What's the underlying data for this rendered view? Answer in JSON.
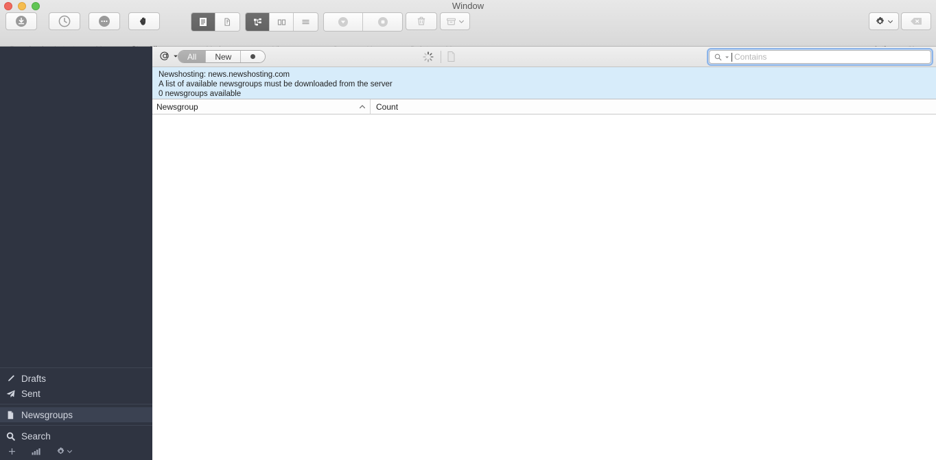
{
  "window": {
    "title": "Window",
    "traffic_lights": [
      "close",
      "minimize",
      "zoom"
    ]
  },
  "toolbar": {
    "groups": [
      {
        "name": "download",
        "buttons": [
          {
            "icon": "download-circle-icon",
            "label": "Download",
            "enabled": false
          },
          {
            "icon": "clock-icon",
            "label": "Latest",
            "enabled": false
          },
          {
            "icon": "ellipsis-circle-icon",
            "label": "More",
            "enabled": false
          },
          {
            "icon": "stop-hand-icon",
            "label": "Stop All",
            "enabled": true
          }
        ]
      }
    ],
    "mode": {
      "label": "Mode",
      "segments": [
        {
          "icon": "article-view-icon",
          "selected": true
        },
        {
          "icon": "pages-copy-icon",
          "selected": false
        }
      ]
    },
    "view": {
      "label": "View",
      "segments": [
        {
          "icon": "hierarchy-tree-icon",
          "selected": true
        },
        {
          "icon": "two-column-icon",
          "selected": false
        },
        {
          "icon": "list-lines-icon",
          "selected": false
        }
      ]
    },
    "actions": [
      {
        "icon": "queue-chevron-circle-icon",
        "label": "Queue",
        "enabled": false
      },
      {
        "icon": "unqueue-square-circle-icon",
        "label": "Unqueue",
        "enabled": false
      },
      {
        "icon": "trash-icon",
        "label": "Delete",
        "enabled": false
      },
      {
        "icon": "archive-box-icon",
        "label": "Move",
        "enabled": false,
        "has_chevron": true
      }
    ],
    "right": [
      {
        "icon": "gear-icon",
        "label": "Action",
        "enabled": true,
        "has_chevron": true
      },
      {
        "icon": "clear-backspace-icon",
        "label": "Clear",
        "enabled": false
      }
    ]
  },
  "filterbar": {
    "at_menu": {
      "icon": "at-sign-icon",
      "chevron": "chevron-down-icon"
    },
    "filters": [
      {
        "label": "All",
        "selected": true
      },
      {
        "label": "New",
        "selected": false
      },
      {
        "label": "",
        "selected": false,
        "icon": "dot-icon"
      }
    ],
    "progress_spinner": "loading-spinner-icon",
    "document_icon": "document-icon",
    "search": {
      "icon": "search-magnifier-icon",
      "chevron": "chevron-down-icon",
      "placeholder": "Contains",
      "value": "",
      "focused": true
    }
  },
  "banner": {
    "lines": [
      "Newshosting: news.newshosting.com",
      "A list of available newsgroups must be downloaded from the server",
      "0 newsgroups available"
    ],
    "background_color": "#d7ecfa"
  },
  "table": {
    "columns": [
      {
        "label": "Newsgroup",
        "sort": "ascending"
      },
      {
        "label": "Count",
        "sort": "none"
      }
    ],
    "rows": []
  },
  "sidebar": {
    "background_color": "#2f3441",
    "selected_color": "#3b4252",
    "groups": [
      {
        "items": [
          {
            "icon": "pencil-icon",
            "label": "Drafts",
            "selected": false
          },
          {
            "icon": "paper-plane-icon",
            "label": "Sent",
            "selected": false
          }
        ]
      },
      {
        "items": [
          {
            "icon": "document-icon",
            "label": "Newsgroups",
            "selected": true
          }
        ]
      },
      {
        "items": [
          {
            "icon": "search-magnifier-icon",
            "label": "Search",
            "selected": false
          }
        ]
      }
    ],
    "footer": [
      {
        "icon": "plus-icon",
        "name": "add-button"
      },
      {
        "icon": "signal-bars-icon",
        "name": "statistics-button"
      },
      {
        "icon": "gear-icon",
        "name": "settings-button",
        "has_chevron": true
      }
    ]
  }
}
